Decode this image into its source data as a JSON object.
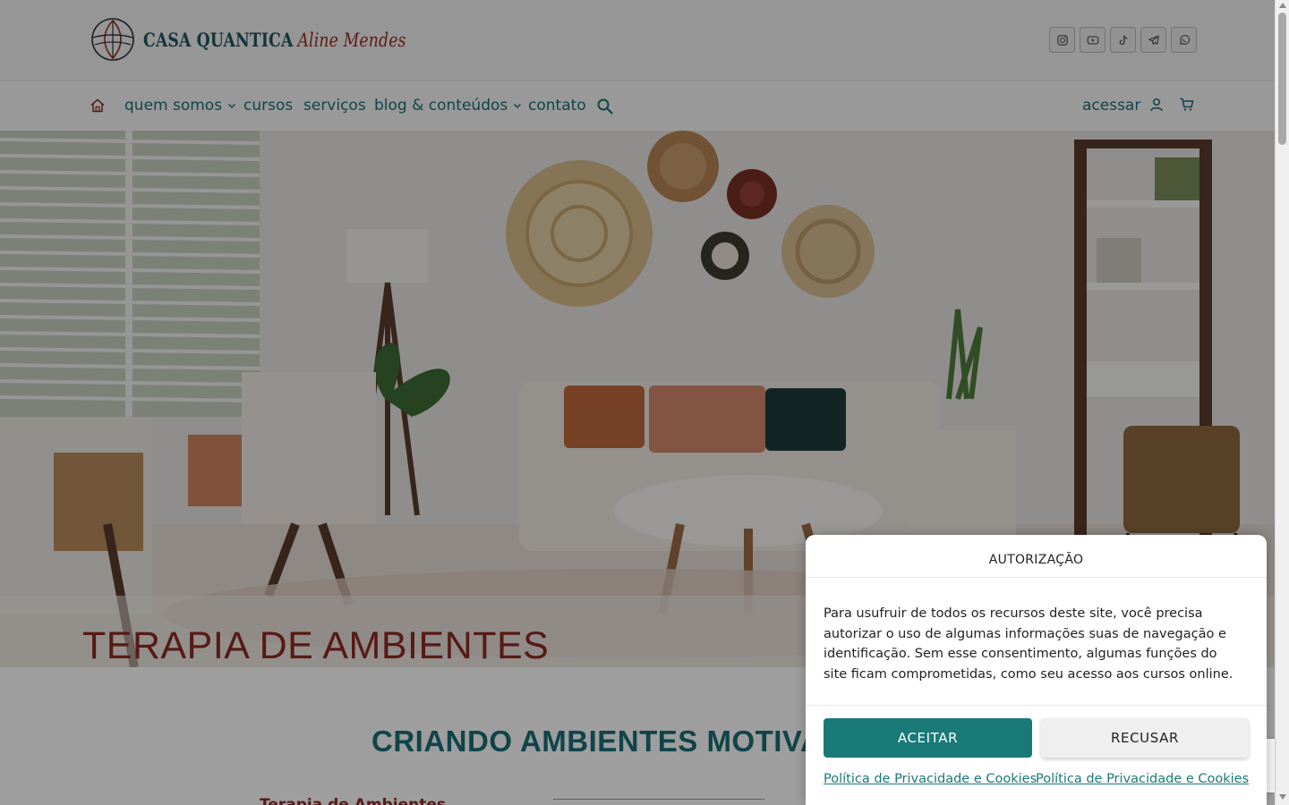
{
  "brand": {
    "name": "CASA QUANTICA",
    "sub": "Aline Mendes"
  },
  "social": [
    "instagram-icon",
    "youtube-icon",
    "tiktok-icon",
    "telegram-icon",
    "whatsapp-icon"
  ],
  "nav": {
    "items": [
      {
        "label": "quem somos",
        "dropdown": true
      },
      {
        "label": "cursos",
        "dropdown": false
      },
      {
        "label": "serviços",
        "dropdown": false
      },
      {
        "label": "blog & conteúdos",
        "dropdown": true
      },
      {
        "label": "contato",
        "dropdown": false
      }
    ],
    "login_label": "acessar"
  },
  "hero": {
    "title": "TERAPIA DE AMBIENTES"
  },
  "section": {
    "title": "CRIANDO AMBIENTES MOTIVA",
    "para_start": "Terapia de Ambientes"
  },
  "consent": {
    "title": "AUTORIZAÇÃO",
    "body": "Para usufruir de todos os recursos deste site, você precisa autorizar o uso de algumas informações suas de navegação e identificação. Sem esse consentimento, algumas funções do site ficam comprometidas, como seu acesso aos cursos online.",
    "accept": "ACEITAR",
    "refuse": "RECUSAR",
    "policy_link_1": "Política de Privacidade e Cookies",
    "policy_link_2": "Política de Privacidade e Cookies"
  },
  "colors": {
    "teal": "#1a6e77",
    "brand_red": "#8d2a22",
    "accept_button": "#197a78"
  }
}
